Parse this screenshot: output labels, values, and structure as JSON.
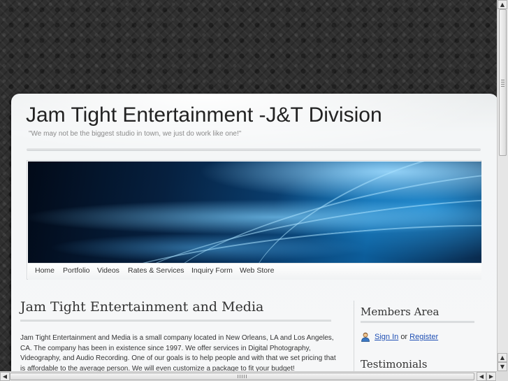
{
  "site": {
    "title": "Jam Tight Entertainment -J&T Division",
    "tagline": "\"We may not be the biggest studio in town, we just do work like one!\""
  },
  "nav": {
    "items": [
      "Home",
      "Portfolio",
      "Videos",
      "Rates & Services",
      "Inquiry Form",
      "Web Store"
    ]
  },
  "content": {
    "title": "Jam Tight Entertainment and Media",
    "body": "Jam Tight Entertainment and Media is a small company located in New Orleans, LA and Los Angeles, CA. The company has been in existence since 1997. We offer services in Digital Photography, Videography, and Audio Recording.  One of our goals is to help people and with that we set pricing that is affordable to the average person. We will even customize a package to fit your budget!"
  },
  "sidebar": {
    "members_title": "Members Area",
    "sign_in": "Sign In",
    "or": "or",
    "register": "Register",
    "testimonials_title": "Testimonials",
    "member_icon": "user-icon"
  },
  "scrollbars": {
    "up_arrow": "▲",
    "down_arrow": "▼",
    "left_arrow": "◀",
    "right_arrow": "▶"
  }
}
